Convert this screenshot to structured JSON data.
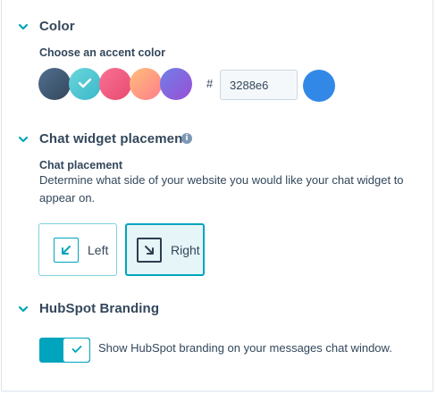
{
  "color_section": {
    "title": "Color",
    "label": "Choose an accent color",
    "swatches": [
      {
        "name": "slate",
        "color": "#425b76"
      },
      {
        "name": "teal",
        "color": "#51c9d2",
        "selected": true
      },
      {
        "name": "pink",
        "color": "#ef5a7c"
      },
      {
        "name": "orange",
        "color": "#ff9f7a"
      },
      {
        "name": "purple",
        "color": "#8b5ae0"
      }
    ],
    "hash_symbol": "#",
    "hex_value": "3288e6",
    "preview_color": "#3288e6"
  },
  "placement_section": {
    "title": "Chat widget placement",
    "info_icon": "i",
    "sub_title": "Chat placement",
    "description_line1": "Determine what side of your website you would like your chat widget to",
    "description_line2": "appear on.",
    "options": [
      {
        "label": "Left",
        "icon": "arrow-down-left-icon",
        "selected": false
      },
      {
        "label": "Right",
        "icon": "arrow-down-right-icon",
        "selected": true
      }
    ]
  },
  "branding_section": {
    "title": "HubSpot Branding",
    "toggle_on": true,
    "toggle_label": "Show HubSpot branding on your messages chat window."
  },
  "colors": {
    "accent": "#00a4bd",
    "text": "#33475b"
  }
}
